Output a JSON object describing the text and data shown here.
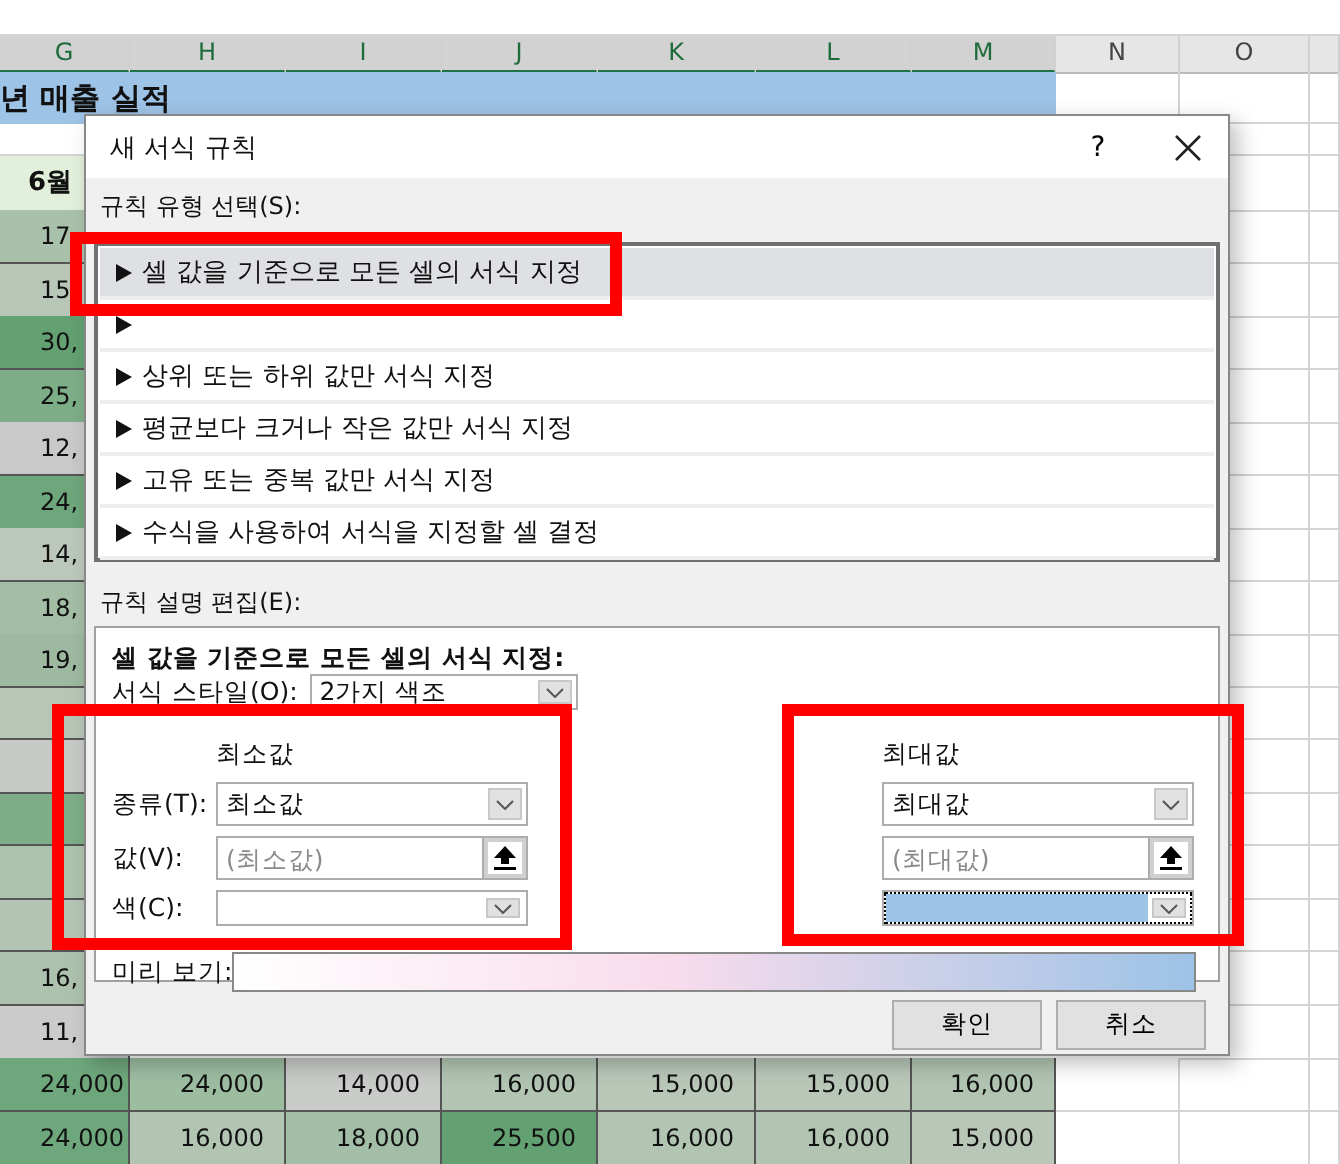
{
  "sheet": {
    "columns": [
      {
        "label": "G",
        "selected": true
      },
      {
        "label": "H",
        "selected": true
      },
      {
        "label": "I",
        "selected": true
      },
      {
        "label": "J",
        "selected": true
      },
      {
        "label": "K",
        "selected": true
      },
      {
        "label": "L",
        "selected": true
      },
      {
        "label": "M",
        "selected": true
      },
      {
        "label": "N",
        "selected": false
      },
      {
        "label": "O",
        "selected": false
      }
    ],
    "title": "년 매출 실적",
    "month_header": "6월",
    "rows": [
      {
        "cells": [
          {
            "text": "17",
            "color": "#a9c1aa"
          }
        ]
      },
      {
        "cells": [
          {
            "text": "15",
            "color": "#b7c6b7"
          }
        ]
      },
      {
        "cells": [
          {
            "text": "30,",
            "color": "#63a072"
          }
        ]
      },
      {
        "cells": [
          {
            "text": "25,",
            "color": "#7dae87"
          }
        ]
      },
      {
        "cells": [
          {
            "text": "12,",
            "color": "#c9c9c9"
          }
        ]
      },
      {
        "cells": [
          {
            "text": "24,",
            "color": "#6fa77c"
          }
        ]
      },
      {
        "cells": [
          {
            "text": "14,",
            "color": "#bcc8bc"
          }
        ]
      },
      {
        "cells": [
          {
            "text": "18,",
            "color": "#a4bea5"
          }
        ]
      },
      {
        "cells": [
          {
            "text": "19,",
            "color": "#9dbaa0"
          }
        ]
      },
      {
        "cells": [
          {
            "color": "#b7c6b7"
          }
        ]
      },
      {
        "cells": [
          {
            "color": "#c6c9c6"
          }
        ]
      },
      {
        "cells": [
          {
            "color": "#7dae87"
          }
        ]
      },
      {
        "cells": [
          {
            "color": "#aec3ae"
          }
        ]
      },
      {
        "cells": [
          {
            "color": "#b5c5b5"
          }
        ]
      },
      {
        "cells": [
          {
            "text": "16,",
            "color": "#adc2ae"
          }
        ]
      },
      {
        "cells": [
          {
            "text": "11,",
            "color": "#cbcbcb"
          }
        ]
      },
      {
        "cells": [
          {
            "text": "24,000",
            "color": "#6fa77c"
          },
          {
            "text": "24,000",
            "color": "#9dbda1"
          },
          {
            "text": "14,000",
            "color": "#c8cbc8"
          },
          {
            "text": "16,000",
            "color": "#b2c5b3"
          },
          {
            "text": "15,000",
            "color": "#b9c7b9"
          },
          {
            "text": "15,000",
            "color": "#b9c7b9"
          },
          {
            "text": "16,000",
            "color": "#b2c5b3"
          }
        ]
      },
      {
        "cells": [
          {
            "text": "24,000",
            "color": "#6fa77c"
          },
          {
            "text": "16,000",
            "color": "#b2c5b3"
          },
          {
            "text": "18,000",
            "color": "#a3bea6"
          },
          {
            "text": "25,500",
            "color": "#63a072"
          },
          {
            "text": "16,000",
            "color": "#b2c5b3"
          },
          {
            "text": "16,000",
            "color": "#b2c5b3"
          },
          {
            "text": "15,000",
            "color": "#b9c7b9"
          }
        ]
      }
    ]
  },
  "dialog": {
    "title": "새 서식 규칙",
    "help": "?",
    "rule_type_label": "규칙 유형 선택(S):",
    "rule_types": [
      {
        "label": "셀 값을 기준으로 모든 셀의 서식 지정",
        "selected": true,
        "highlighted": true
      },
      {
        "selected": false,
        "highlighted": false
      },
      {
        "label": "상위 또는 하위 값만 서식 지정",
        "selected": false,
        "highlighted": false
      },
      {
        "label": "평균보다 크거나 작은 값만 서식 지정",
        "selected": false,
        "highlighted": false
      },
      {
        "label": "고유 또는 중복 값만 서식 지정",
        "selected": false,
        "highlighted": false
      },
      {
        "label": "수식을 사용하여 서식을 지정할 셀 결정",
        "selected": false,
        "highlighted": false
      }
    ],
    "description_label": "규칙 설명 편집(E):",
    "heading": "셀 값을 기준으로 모든 셀의 서식 지정:",
    "style_label": "서식 스타일(O):",
    "style_value": "2가지 색조",
    "type_label": "종류(T):",
    "value_label": "값(V):",
    "color_label": "색(C):",
    "min": {
      "heading": "최소값",
      "type": "최소값",
      "value_placeholder": "(최소값)",
      "color": "#ffffff",
      "focused": false,
      "highlighted": true
    },
    "max": {
      "heading": "최대값",
      "type": "최대값",
      "value_placeholder": "(최대값)",
      "color": "#9dc3e6",
      "focused": true,
      "highlighted": true
    },
    "preview_label": "미리 보기:",
    "buttons": [
      {
        "label": "확인"
      },
      {
        "label": "취소"
      }
    ]
  }
}
